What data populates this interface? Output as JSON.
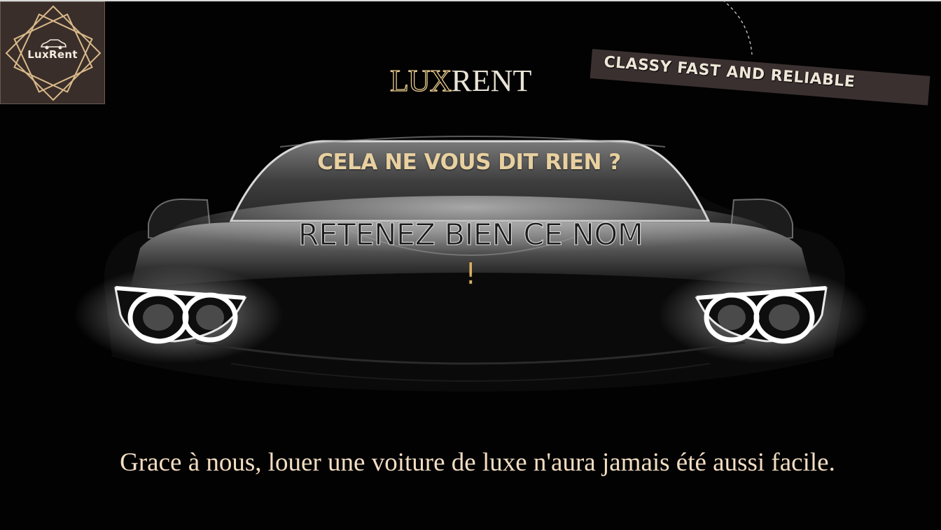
{
  "logo": {
    "text": "LuxRent",
    "icon": "car-icon",
    "bg_color": "#3a2e2a",
    "frame_color": "#d9b98a"
  },
  "header": {
    "title_part1": "LUX",
    "title_part2": "RENT",
    "tagline": "CLASSY FAST AND RELIABLE"
  },
  "hero": {
    "question": "CELA NE VOUS DIT RIEN ?",
    "remember": "RETENEZ BIEN CE NOM",
    "exclamation": "!"
  },
  "footer": {
    "message": "Grace à nous, louer une voiture de luxe n'aura jamais été aussi facile."
  },
  "colors": {
    "gold": "#e8c98e",
    "cream": "#f3ddc1",
    "background": "#020202"
  }
}
